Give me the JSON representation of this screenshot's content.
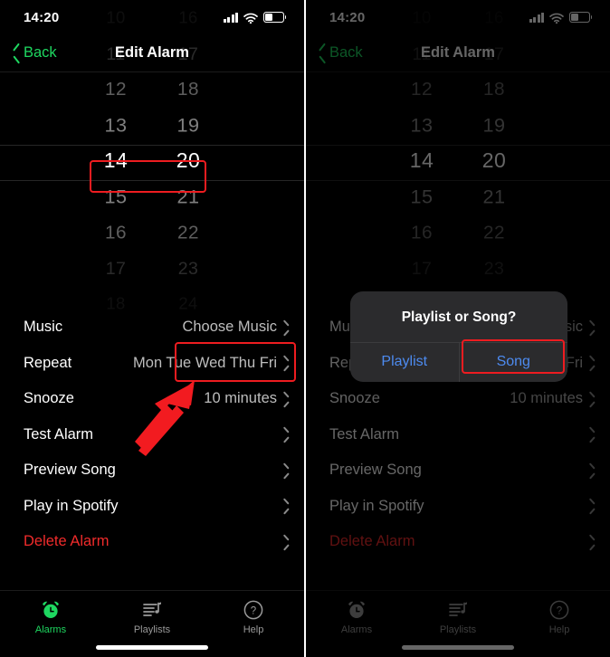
{
  "colors": {
    "accent_green": "#1ed760",
    "danger_red": "#f02b2b",
    "annotation_red": "#ee1c20",
    "ios_blue": "#4d8bf0",
    "background": "#000000",
    "alert_background": "#2b2b2d"
  },
  "status_bar": {
    "time": "14:20",
    "signal_icon": "cellular-signal-icon",
    "wifi_icon": "wifi-icon",
    "battery_icon": "battery-icon",
    "battery_level_pct": 42
  },
  "nav": {
    "back_label": "Back",
    "back_icon": "chevron-left-icon",
    "title": "Edit Alarm"
  },
  "picker": {
    "hours": [
      "10",
      "11",
      "12",
      "13",
      "14",
      "15",
      "16",
      "17",
      "18"
    ],
    "minutes": [
      "16",
      "17",
      "18",
      "19",
      "20",
      "21",
      "22",
      "23",
      "24"
    ],
    "selected_hour": "14",
    "selected_minute": "20"
  },
  "list": {
    "rows": [
      {
        "label": "Music",
        "value": "Choose Music",
        "danger": false
      },
      {
        "label": "Repeat",
        "value": "Mon Tue Wed Thu Fri",
        "danger": false
      },
      {
        "label": "Snooze",
        "value": "10 minutes",
        "danger": false
      },
      {
        "label": "Test Alarm",
        "value": "",
        "danger": false
      },
      {
        "label": "Preview Song",
        "value": "",
        "danger": false
      },
      {
        "label": "Play in Spotify",
        "value": "",
        "danger": false
      },
      {
        "label": "Delete Alarm",
        "value": "",
        "danger": true
      }
    ],
    "chevron_icon": "chevron-right-icon"
  },
  "tabbar": {
    "tabs": [
      {
        "label": "Alarms",
        "icon": "alarm-clock-icon",
        "active": true
      },
      {
        "label": "Playlists",
        "icon": "playlist-music-icon",
        "active": false
      },
      {
        "label": "Help",
        "icon": "question-mark-circle-icon",
        "active": false
      }
    ]
  },
  "alert": {
    "title": "Playlist or Song?",
    "buttons": [
      {
        "label": "Playlist",
        "highlighted": false
      },
      {
        "label": "Song",
        "highlighted": true
      }
    ]
  },
  "annotations": {
    "left_panel": [
      {
        "name": "time-selection-highlight",
        "target": "14 20"
      },
      {
        "name": "choose-music-highlight",
        "target": "Choose Music"
      },
      {
        "name": "pointer-arrow",
        "target": "Choose Music"
      }
    ],
    "right_panel": [
      {
        "name": "song-button-highlight",
        "target": "Song"
      }
    ]
  }
}
